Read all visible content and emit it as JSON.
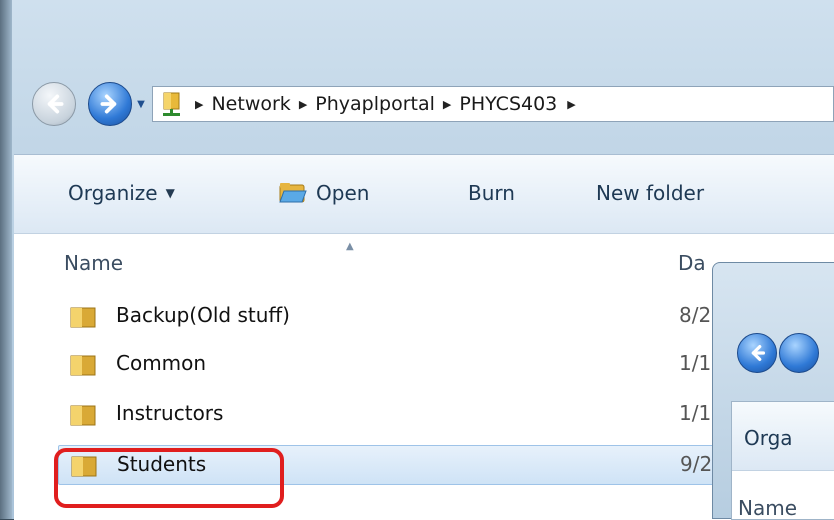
{
  "address_bar": {
    "breadcrumbs": [
      "Network",
      "Phyaplportal",
      "PHYCS403"
    ]
  },
  "toolbar": {
    "organize_label": "Organize",
    "open_label": "Open",
    "burn_label": "Burn",
    "new_folder_label": "New folder"
  },
  "columns": {
    "name": "Name",
    "date": "Da"
  },
  "files": [
    {
      "name": "Backup(Old stuff)",
      "date": "8/2"
    },
    {
      "name": "Common",
      "date": "1/1"
    },
    {
      "name": "Instructors",
      "date": "1/1"
    },
    {
      "name": "Students",
      "date": "9/2"
    }
  ],
  "second_window": {
    "organize_label": "Orga",
    "name_column": "Name"
  },
  "colors": {
    "highlight": "#e01e1e",
    "selection": "#cfe3f6",
    "accent": "#2f79d6"
  },
  "icons": [
    "back-icon",
    "forward-icon",
    "network-folder-icon",
    "folder-icon",
    "open-folder-icon",
    "dropdown-icon"
  ]
}
